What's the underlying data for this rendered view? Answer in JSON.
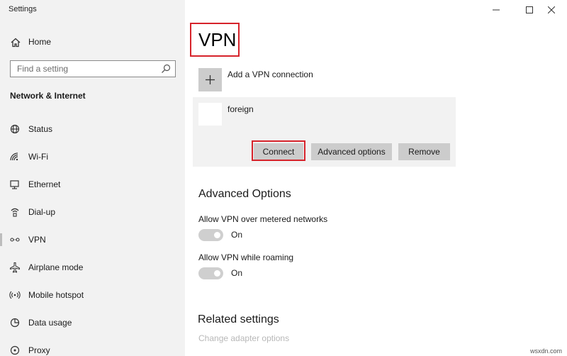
{
  "window": {
    "title": "Settings",
    "minimize_glyph": "—",
    "maximize_glyph": "□",
    "close_glyph": "✕"
  },
  "sidebar": {
    "home_label": "Home",
    "search_placeholder": "Find a setting",
    "section_title": "Network & Internet",
    "items": [
      {
        "label": "Status",
        "icon": "status-icon"
      },
      {
        "label": "Wi-Fi",
        "icon": "wifi-icon"
      },
      {
        "label": "Ethernet",
        "icon": "ethernet-icon"
      },
      {
        "label": "Dial-up",
        "icon": "dial-up-icon"
      },
      {
        "label": "VPN",
        "icon": "vpn-icon",
        "active": true
      },
      {
        "label": "Airplane mode",
        "icon": "airplane-icon"
      },
      {
        "label": "Mobile hotspot",
        "icon": "hotspot-icon"
      },
      {
        "label": "Data usage",
        "icon": "data-usage-icon"
      },
      {
        "label": "Proxy",
        "icon": "proxy-icon"
      }
    ]
  },
  "main": {
    "title": "VPN",
    "add_vpn_label": "Add a VPN connection",
    "connection": {
      "name": "foreign",
      "connect_label": "Connect",
      "advanced_label": "Advanced options",
      "remove_label": "Remove"
    },
    "advanced": {
      "heading": "Advanced Options",
      "settings": [
        {
          "label": "Allow VPN over metered networks",
          "state": "On"
        },
        {
          "label": "Allow VPN while roaming",
          "state": "On"
        }
      ]
    },
    "related": {
      "heading": "Related settings",
      "link": "Change adapter options"
    }
  },
  "watermark": "wsxdn.com",
  "colors": {
    "highlight": "#d6232b",
    "sidebar_bg": "#f2f2f2",
    "button_bg": "#cccccc",
    "toggle_bg": "#cfcfcf"
  }
}
